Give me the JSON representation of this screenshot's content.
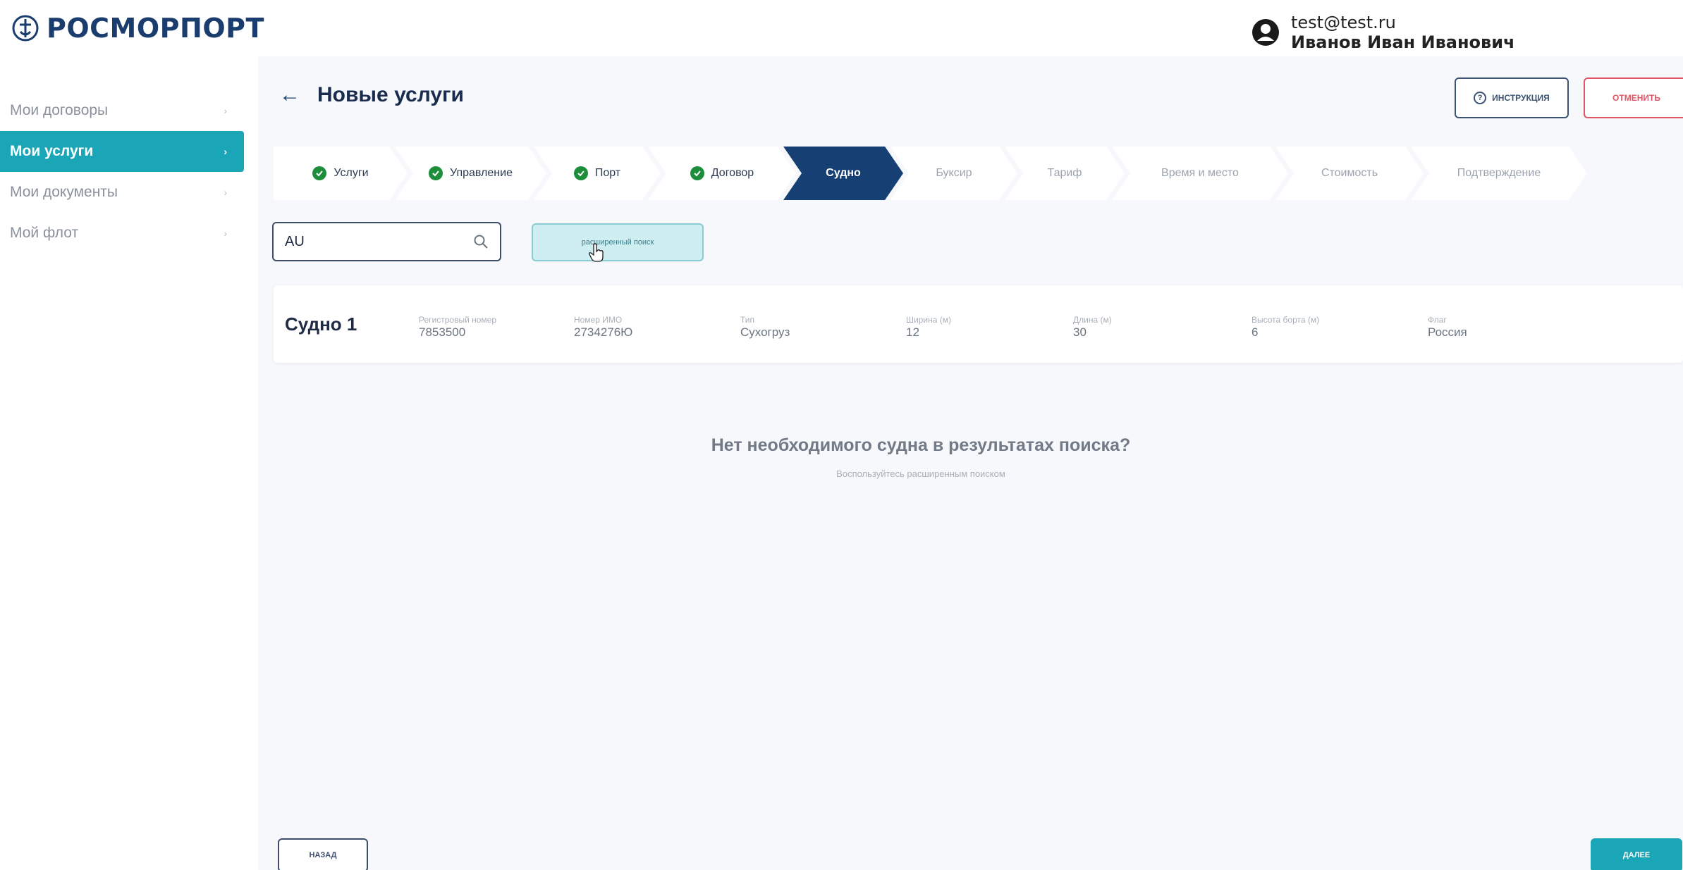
{
  "header": {
    "logo_text": "РОСМОРПОРТ",
    "user_email": "test@test.ru",
    "user_name": "Иванов Иван Иванович"
  },
  "sidebar": {
    "items": [
      {
        "label": "Мои договоры",
        "active": false
      },
      {
        "label": "Мои услуги",
        "active": true
      },
      {
        "label": "Мои документы",
        "active": false
      },
      {
        "label": "Мой флот",
        "active": false
      }
    ]
  },
  "page": {
    "title": "Новые услуги",
    "instruction_label": "инструкция",
    "cancel_label": "отменить"
  },
  "stepper": {
    "steps": [
      {
        "label": "Услуги",
        "state": "done"
      },
      {
        "label": "Управление",
        "state": "done"
      },
      {
        "label": "Порт",
        "state": "done"
      },
      {
        "label": "Договор",
        "state": "done"
      },
      {
        "label": "Судно",
        "state": "active"
      },
      {
        "label": "Буксир",
        "state": "pending"
      },
      {
        "label": "Тариф",
        "state": "pending"
      },
      {
        "label": "Время и место",
        "state": "pending"
      },
      {
        "label": "Стоимость",
        "state": "pending"
      },
      {
        "label": "Подтверждение",
        "state": "pending"
      }
    ]
  },
  "search": {
    "value": "AU",
    "advanced_label": "расширенный поиск"
  },
  "vessel": {
    "name": "Судно 1",
    "fields": [
      {
        "label": "Регистровый номер",
        "value": "7853500"
      },
      {
        "label": "Номер ИМО",
        "value": "2734276Ю"
      },
      {
        "label": "Тип",
        "value": "Сухогруз"
      },
      {
        "label": "Ширина (м)",
        "value": "12"
      },
      {
        "label": "Длина (м)",
        "value": "30"
      },
      {
        "label": "Высота борта (м)",
        "value": "6"
      },
      {
        "label": "Флаг",
        "value": "Россия"
      }
    ]
  },
  "empty_state": {
    "title": "Нет необходимого судна в результатах поиска?",
    "subtitle": "Воспользуйтесь расширенным поиском"
  },
  "footer": {
    "back_label": "назад",
    "next_label": "далее"
  },
  "colors": {
    "accent": "#1aa6b7",
    "active_step": "#163f73",
    "done_check": "#1c8d3a",
    "cancel": "#e05565"
  }
}
